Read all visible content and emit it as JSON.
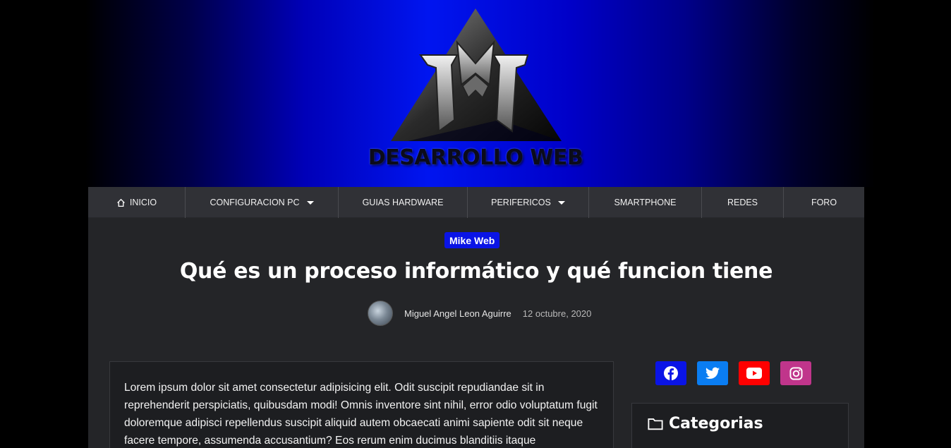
{
  "header": {
    "site_name": "DESARROLLO WEB",
    "logo_icon": "triangle-ma-logo"
  },
  "nav": {
    "items": [
      {
        "label": "INICIO",
        "icon": "home-icon",
        "dropdown": false
      },
      {
        "label": "CONFIGURACION PC",
        "dropdown": true
      },
      {
        "label": "GUIAS HARDWARE",
        "dropdown": false
      },
      {
        "label": "PERIFERICOS",
        "dropdown": true
      },
      {
        "label": "SMARTPHONE",
        "dropdown": false
      },
      {
        "label": "REDES",
        "dropdown": false
      },
      {
        "label": "FORO",
        "dropdown": false
      }
    ]
  },
  "post": {
    "category": "Mike Web",
    "title": "Qué es un proceso informático y qué funcion tiene",
    "author": "Miguel Angel Leon Aguirre",
    "date": "12 octubre, 2020",
    "body": "Lorem ipsum dolor sit amet consectetur adipisicing elit. Odit suscipit repudiandae sit in reprehenderit perspiciatis, quibusdam modi! Omnis inventore sint nihil, error odio voluptatum fugit doloremque adipisci repellendus suscipit aliquid autem obcaecati animi sapiente odit sit neque facere tempore, assumenda accusantium? Eos rerum enim ducimus blanditiis itaque"
  },
  "sidebar": {
    "social": [
      {
        "name": "facebook",
        "icon": "facebook-icon",
        "color": "#0a14e6"
      },
      {
        "name": "twitter",
        "icon": "twitter-icon",
        "color": "#0a7df2"
      },
      {
        "name": "youtube",
        "icon": "youtube-icon",
        "color": "#ff0000"
      },
      {
        "name": "instagram",
        "icon": "instagram-icon",
        "color": "#c0358b"
      }
    ],
    "categories_title": "Categorias"
  },
  "colors": {
    "accent": "#0a14e6",
    "nav_bg": "#303136",
    "content_bg": "#242528"
  }
}
